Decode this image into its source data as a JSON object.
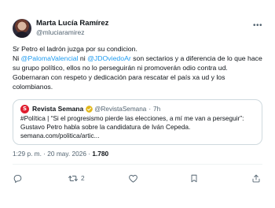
{
  "author": {
    "display_name": "Marta Lucía Ramírez",
    "handle": "@mluciaramirez"
  },
  "tweet": {
    "line1": "Sr Petro el ladrón juzga por su condicion.",
    "line2_pre": "Ni ",
    "mention1": "@PalomaValencial",
    "line2_mid": " ni ",
    "mention2": "@JDOviedoAr",
    "line2_post": " son sectarios y a diferencia de lo que hace su grupo político, ellos no lo perseguirán ni promoverán odio contra ud. Gobernaran con respeto y dedicación para rescatar el país xa ud y los colombianos."
  },
  "quote": {
    "logo_letter": "S",
    "name": "Revista Semana",
    "handle": "@RevistaSemana",
    "separator": "·",
    "time": "7h",
    "text_line1": "#Política | “Si el progresismo pierde las elecciones, a mí me van a perseguir”:",
    "text_line2": "Gustavo Petro habla sobre la candidatura de Iván Cepeda.",
    "text_line3": "semana.com/politica/artic..."
  },
  "meta": {
    "time": "1:29 p. m.",
    "sep1": " · ",
    "date": "20 may. 2026",
    "sep2": " · ",
    "views": "1.780"
  },
  "actions": {
    "reply_count": "",
    "retweet_count": "2",
    "like_count": ""
  },
  "colors": {
    "accent": "#1d9bf0",
    "secondary_text": "#536471",
    "semana_red": "#e01e2f",
    "verified_gold": "#e2b719"
  },
  "icons": {
    "menu": "more-options-icon",
    "reply": "reply-icon",
    "retweet": "retweet-icon",
    "like": "heart-icon",
    "bookmark": "bookmark-icon",
    "share": "share-icon",
    "verified": "verified-badge-icon"
  }
}
